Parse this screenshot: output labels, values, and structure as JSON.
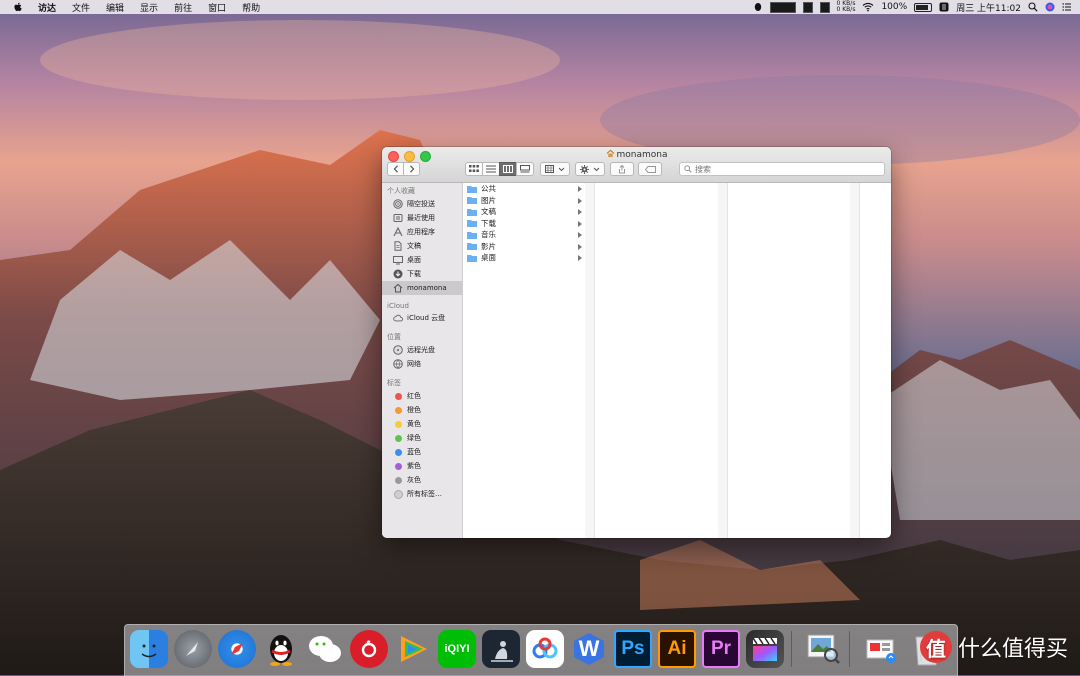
{
  "menubar": {
    "app_name": "访达",
    "menus": [
      "文件",
      "编辑",
      "显示",
      "前往",
      "窗口",
      "帮助"
    ],
    "net_up": "0 KB/s",
    "net_down": "0 KB/s",
    "battery": "100%",
    "clock": "周三 上午11:02"
  },
  "window": {
    "title": "monamona",
    "search_placeholder": "搜索"
  },
  "sidebar": {
    "favorites_header": "个人收藏",
    "favorites": [
      {
        "label": "隔空投送",
        "icon": "airdrop-icon"
      },
      {
        "label": "最近使用",
        "icon": "recents-icon"
      },
      {
        "label": "应用程序",
        "icon": "applications-icon"
      },
      {
        "label": "文稿",
        "icon": "documents-icon"
      },
      {
        "label": "桌面",
        "icon": "desktop-icon"
      },
      {
        "label": "下载",
        "icon": "downloads-icon"
      },
      {
        "label": "monamona",
        "icon": "home-icon"
      }
    ],
    "icloud_header": "iCloud",
    "icloud": [
      {
        "label": "iCloud 云盘",
        "icon": "cloud-icon"
      }
    ],
    "locations_header": "位置",
    "locations": [
      {
        "label": "远程光盘",
        "icon": "disc-icon"
      },
      {
        "label": "网络",
        "icon": "network-icon"
      }
    ],
    "tags_header": "标签",
    "tags": [
      {
        "label": "红色",
        "color": "#f0524f"
      },
      {
        "label": "橙色",
        "color": "#f39a35"
      },
      {
        "label": "黄色",
        "color": "#f5cd3a"
      },
      {
        "label": "绿色",
        "color": "#5dc453"
      },
      {
        "label": "蓝色",
        "color": "#3a8ef0"
      },
      {
        "label": "紫色",
        "color": "#a35fd6"
      },
      {
        "label": "灰色",
        "color": "#9a9a9a"
      },
      {
        "label": "所有标签…",
        "color": "#cfcfcf"
      }
    ]
  },
  "column1": {
    "items": [
      "公共",
      "图片",
      "文稿",
      "下载",
      "音乐",
      "影片",
      "桌面"
    ]
  },
  "dock": {
    "apps": [
      {
        "name": "finder-icon",
        "glyph": ""
      },
      {
        "name": "launchpad-icon",
        "glyph": ""
      },
      {
        "name": "safari-icon",
        "glyph": ""
      },
      {
        "name": "qq-icon",
        "glyph": ""
      },
      {
        "name": "wechat-icon",
        "glyph": ""
      },
      {
        "name": "netease-music-icon",
        "glyph": ""
      },
      {
        "name": "tencent-video-icon",
        "glyph": ""
      },
      {
        "name": "iqiyi-icon",
        "glyph": "iQIYI"
      },
      {
        "name": "kindle-icon",
        "glyph": ""
      },
      {
        "name": "baidu-netdisk-icon",
        "glyph": ""
      },
      {
        "name": "wps-icon",
        "glyph": "W"
      },
      {
        "name": "photoshop-icon",
        "glyph": "Ps"
      },
      {
        "name": "illustrator-icon",
        "glyph": "Ai"
      },
      {
        "name": "premiere-icon",
        "glyph": "Pr"
      },
      {
        "name": "final-cut-icon",
        "glyph": ""
      },
      {
        "name": "preview-icon",
        "glyph": ""
      },
      {
        "name": "downloads-stack-icon",
        "glyph": ""
      },
      {
        "name": "trash-icon",
        "glyph": ""
      }
    ]
  },
  "watermark": {
    "text": "什么值得买",
    "logo": "值"
  },
  "colors": {
    "sidebar_bg": "#e8e6e8",
    "selected_bg": "#cbc9cb",
    "folder_blue": "#6ab0f3"
  }
}
